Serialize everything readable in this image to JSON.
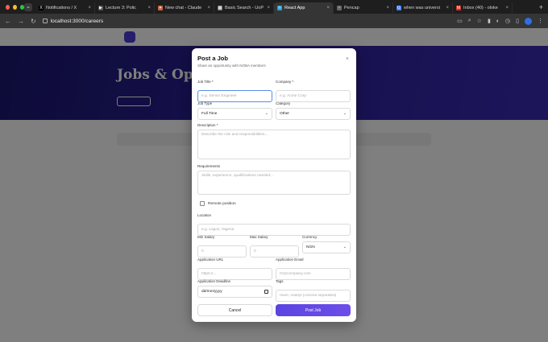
{
  "browser": {
    "tabs": [
      {
        "title": "Notifications / X",
        "fav": "X",
        "color": "#000000"
      },
      {
        "title": "Lecture 3: Polic",
        "fav": "▶",
        "color": "#555555"
      },
      {
        "title": "New chat - Claude",
        "fav": "✦",
        "color": "#c96442"
      },
      {
        "title": "Basic Search - UoP",
        "fav": "▦",
        "color": "#777777"
      },
      {
        "title": "React App",
        "fav": "⚛",
        "color": "#2a9fd6",
        "active": true
      },
      {
        "title": "Pencap",
        "fav": "~",
        "color": "#666666"
      },
      {
        "title": "when was universi",
        "fav": "G",
        "color": "#4285f4"
      },
      {
        "title": "Inbox (40) - oloke",
        "fav": "M",
        "color": "#d93025"
      }
    ],
    "url": "localhost:3000/careers"
  },
  "page": {
    "hero_title": "Jobs & Oppor"
  },
  "modal": {
    "title": "Post a Job",
    "subtitle": "Share an opportunity with NOBA members",
    "job_title_label": "Job Title *",
    "job_title_placeholder": "e.g. Senior Engineer",
    "company_label": "Company *",
    "company_placeholder": "e.g. Acme Corp",
    "job_type_label": "Job Type",
    "job_type_value": "Full Time",
    "category_label": "Category",
    "category_value": "Other",
    "description_label": "Description *",
    "description_placeholder": "Describe the role and responsibilities...",
    "requirements_label": "Requirements",
    "requirements_placeholder": "Skills, experience, qualifications needed...",
    "remote_label": "Remote position",
    "location_label": "Location",
    "location_placeholder": "e.g. Lagos, Nigeria",
    "min_salary_label": "Min Salary",
    "min_salary_placeholder": "0",
    "max_salary_label": "Max Salary",
    "max_salary_placeholder": "0",
    "currency_label": "Currency",
    "currency_value": "NGN",
    "app_url_label": "Application URL",
    "app_url_placeholder": "https://...",
    "app_email_label": "Application Email",
    "app_email_placeholder": "hr@company.com",
    "deadline_label": "Application Deadline",
    "deadline_value": "dd/mm/yyyy",
    "tags_label": "Tags",
    "tags_placeholder": "react, nodejs (comma separated)",
    "cancel_label": "Cancel",
    "post_label": "Post Job"
  }
}
